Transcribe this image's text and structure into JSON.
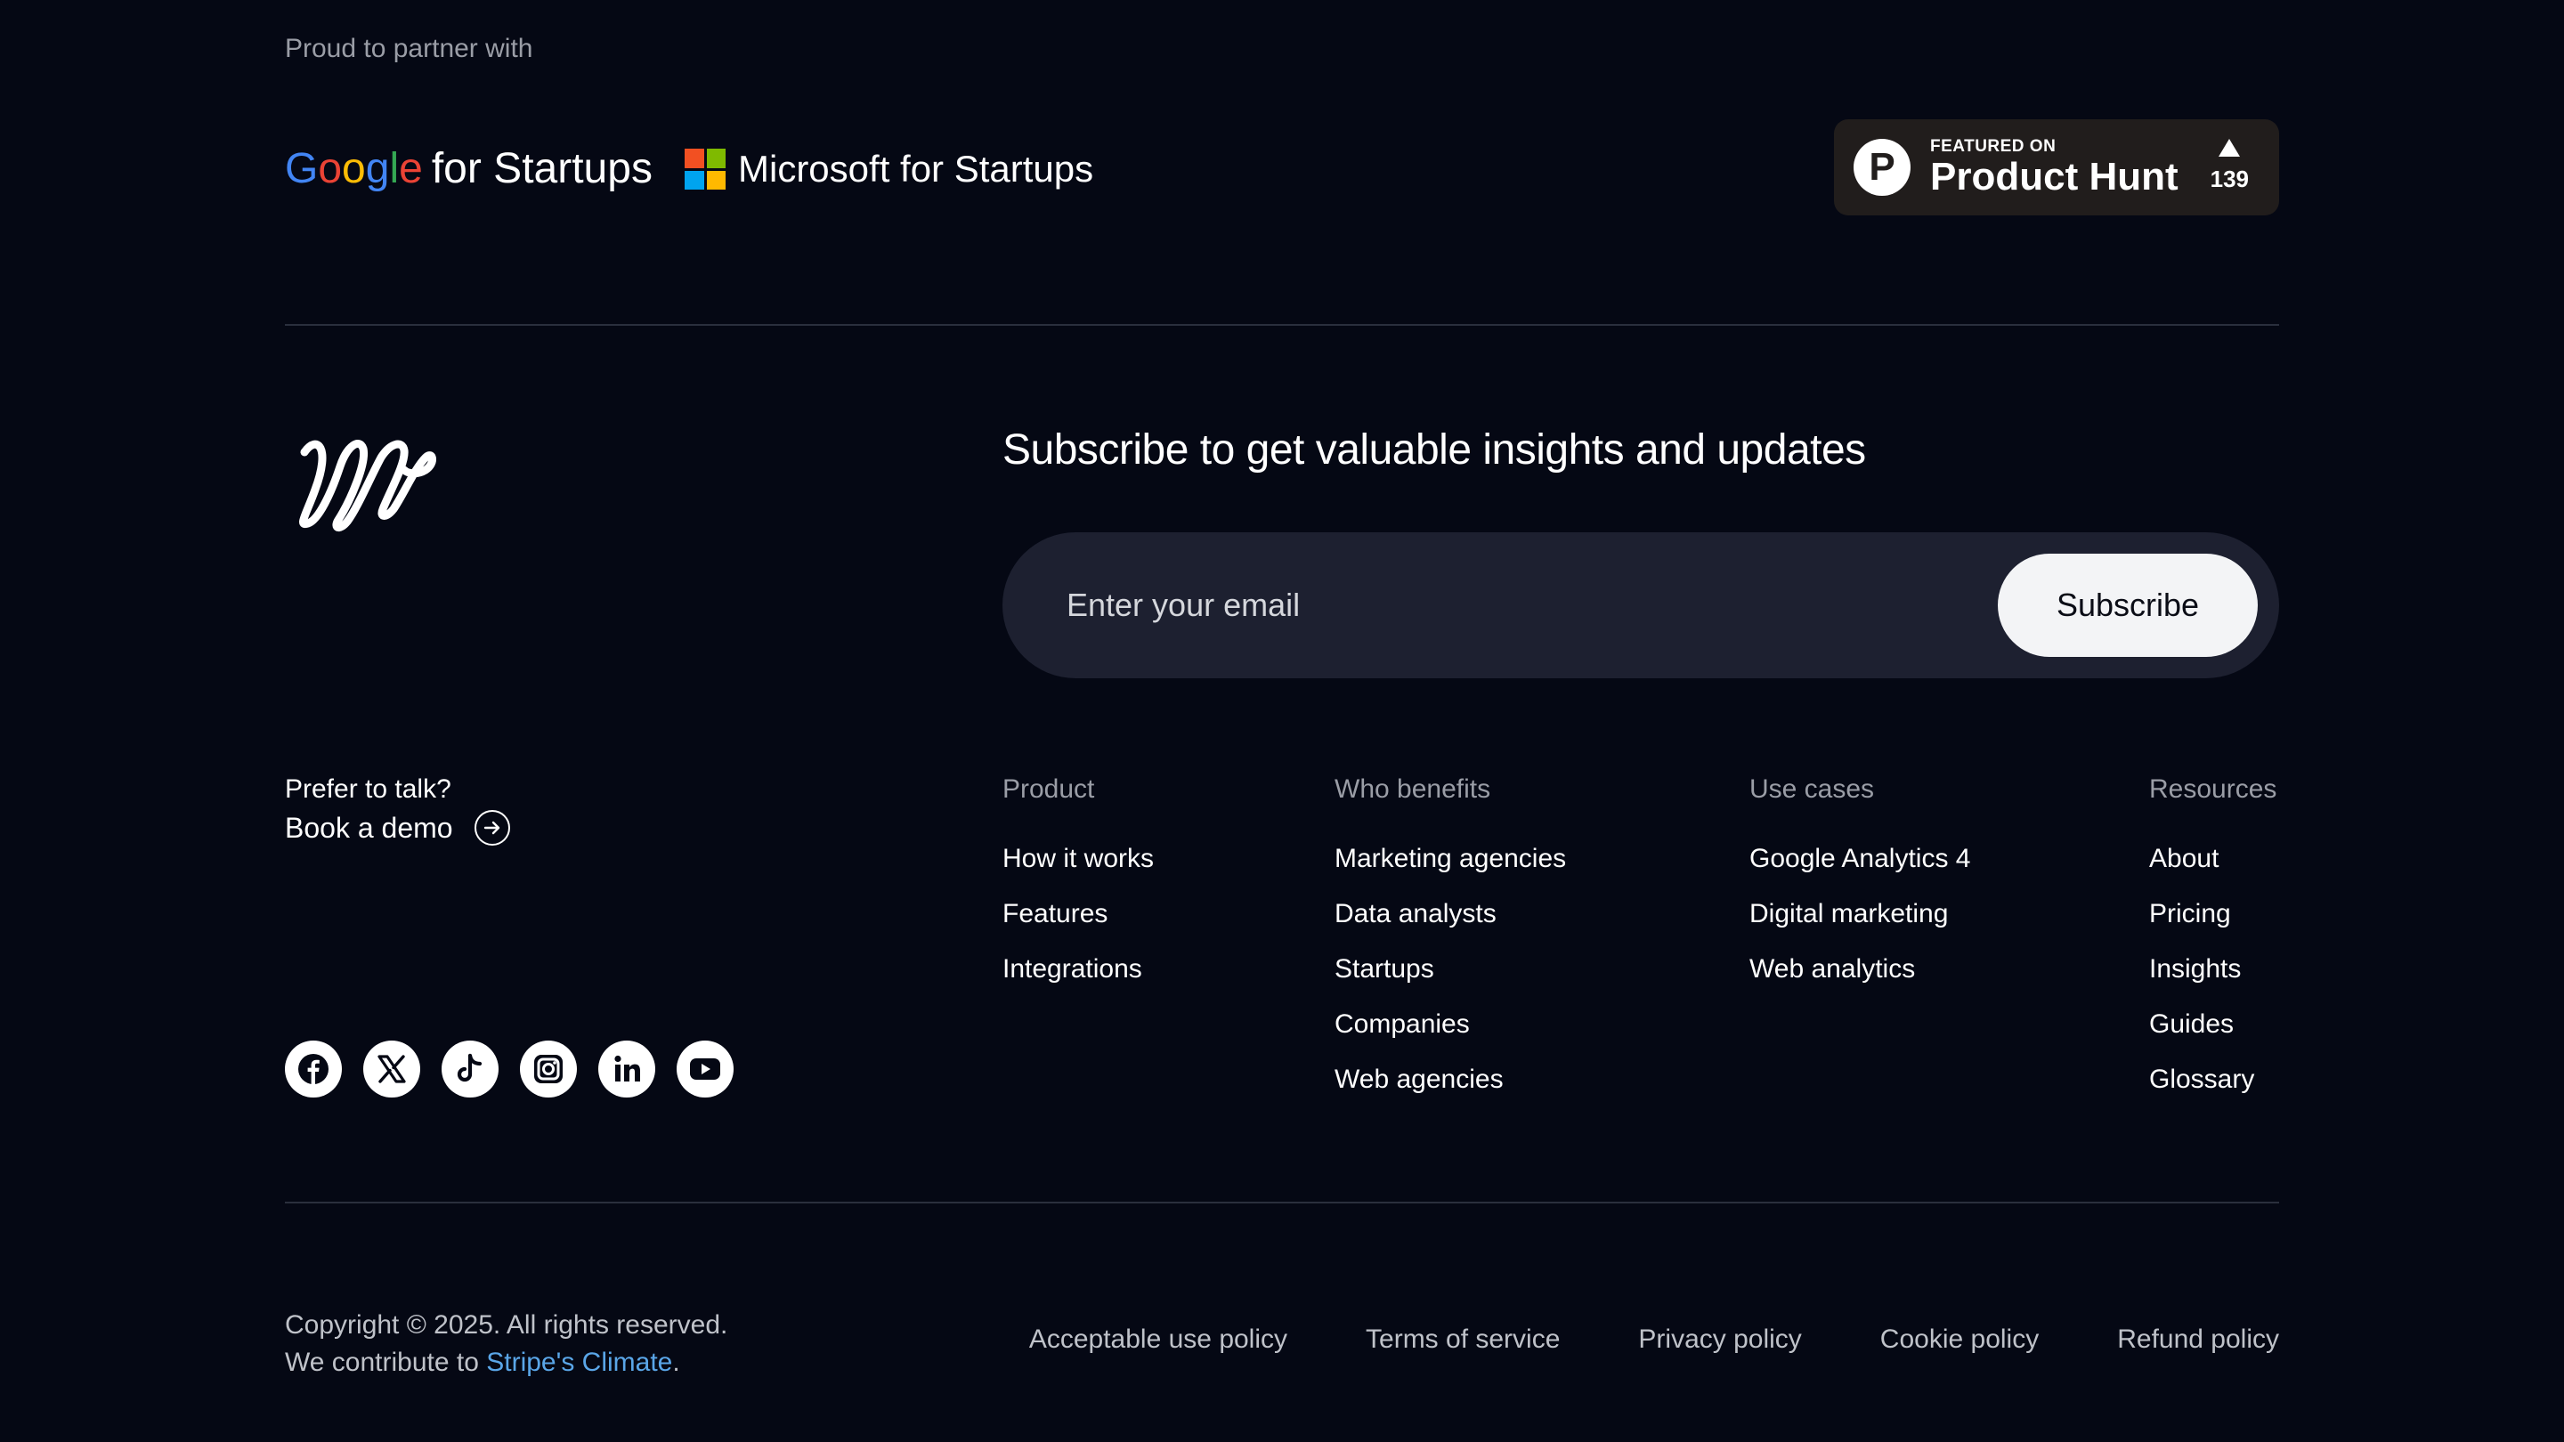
{
  "partners": {
    "title": "Proud to partner with",
    "google": {
      "letters": [
        "G",
        "o",
        "o",
        "g",
        "l",
        "e"
      ],
      "suffix": "for Startups"
    },
    "microsoft": {
      "label": "Microsoft for Startups"
    },
    "product_hunt": {
      "featured_label": "FEATURED ON",
      "name": "Product Hunt",
      "logo_letter": "P",
      "votes": "139"
    }
  },
  "subscribe": {
    "title": "Subscribe to get valuable insights and updates",
    "email_placeholder": "Enter your email",
    "email_value": "",
    "button_label": "Subscribe"
  },
  "talk": {
    "question": "Prefer to talk?",
    "book_demo_label": "Book a demo"
  },
  "columns": [
    {
      "heading": "Product",
      "links": [
        "How it works",
        "Features",
        "Integrations"
      ]
    },
    {
      "heading": "Who benefits",
      "links": [
        "Marketing agencies",
        "Data analysts",
        "Startups",
        "Companies",
        "Web agencies"
      ]
    },
    {
      "heading": "Use cases",
      "links": [
        "Google Analytics 4",
        "Digital marketing",
        "Web analytics"
      ]
    },
    {
      "heading": "Resources",
      "links": [
        "About",
        "Pricing",
        "Insights",
        "Guides",
        "Glossary"
      ]
    }
  ],
  "social": [
    "facebook-icon",
    "x-icon",
    "tiktok-icon",
    "instagram-icon",
    "linkedin-icon",
    "youtube-icon"
  ],
  "footer": {
    "copyright": "Copyright © 2025. All rights reserved.",
    "contribute_prefix": "We contribute to ",
    "contribute_link": "Stripe's Climate",
    "contribute_suffix": ".",
    "legal_links": [
      "Acceptable use policy",
      "Terms of service",
      "Privacy policy",
      "Cookie policy",
      "Refund policy"
    ]
  },
  "colors": {
    "background": "#050814",
    "input_background": "#1d2030",
    "link_accent": "#5aa6e8",
    "product_hunt_badge": "#211d1c"
  }
}
